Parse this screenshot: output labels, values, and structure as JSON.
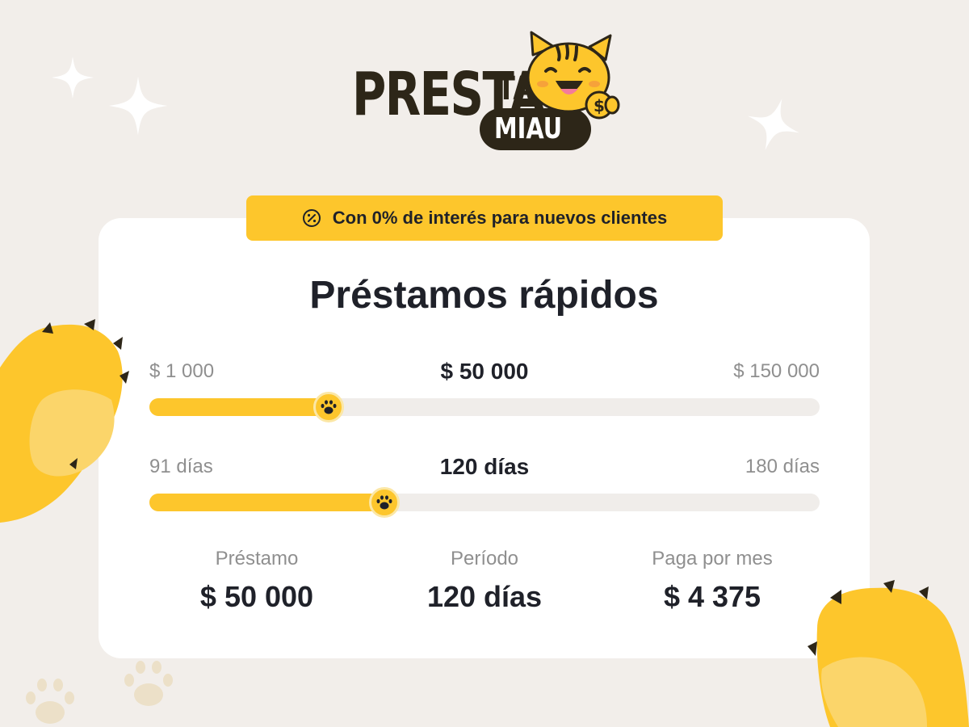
{
  "brand": {
    "name_main": "PRESTA",
    "name_ta": "TA",
    "name_sub": "MIAU"
  },
  "badge": {
    "text": "Con 0% de interés para nuevos clientes",
    "icon": "percent-icon"
  },
  "title": "Préstamos rápidos",
  "amount_slider": {
    "min_label": "$ 1 000",
    "max_label": "$ 150 000",
    "value_label": "$ 50 000",
    "fraction": 0.267
  },
  "term_slider": {
    "min_label": "91 días",
    "max_label": "180 días",
    "value_label": "120 días",
    "fraction": 0.35
  },
  "summary": [
    {
      "label": "Préstamo",
      "value": "$ 50 000"
    },
    {
      "label": "Período",
      "value": "120 días"
    },
    {
      "label": "Paga por mes",
      "value": "$ 4 375"
    }
  ],
  "colors": {
    "accent": "#fdc62c",
    "text": "#1f2129",
    "muted": "#8f8f8f",
    "background": "#f2eeea"
  }
}
